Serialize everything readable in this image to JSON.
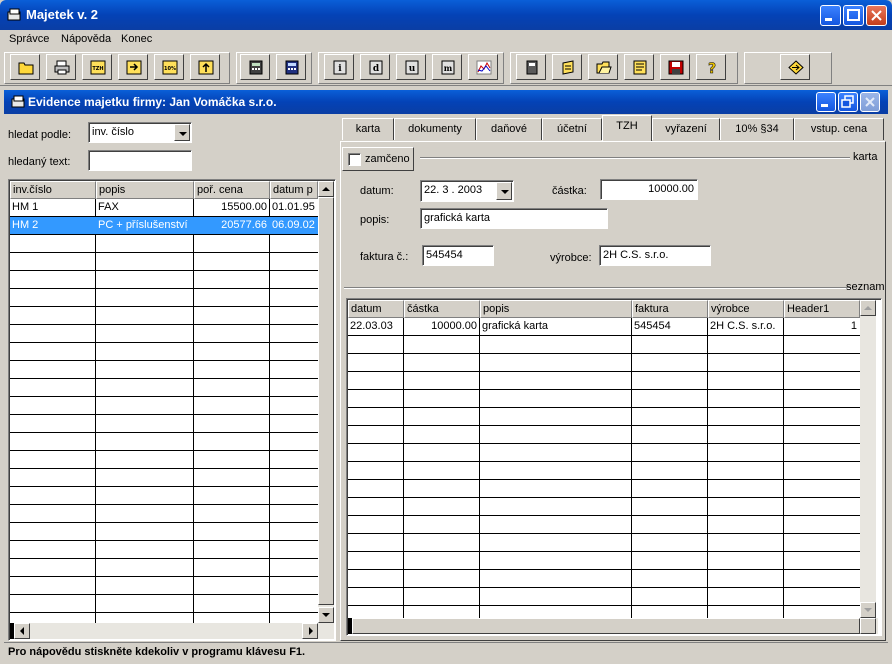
{
  "app": {
    "title": "Majetek v. 2",
    "menu": [
      "Správce",
      "Nápověda",
      "Konec"
    ],
    "menu_underline": [
      "S",
      "N",
      "K"
    ]
  },
  "toolbar": {
    "icons": [
      "folder-icon",
      "printer-icon",
      "tzh-icon",
      "export-icon",
      "percent-icon",
      "upload-icon",
      "calculator-icon",
      "calculator-blue-icon",
      "info-i-icon",
      "info-d-icon",
      "info-u-icon",
      "info-m-icon",
      "chart-icon",
      "book-icon",
      "edit-card-icon",
      "open-folder-icon",
      "note-icon",
      "save-disk-icon",
      "help-icon",
      "exit-diamond-icon"
    ],
    "icon_labels": {
      "tzh": "TZH",
      "percent": "10%"
    }
  },
  "child": {
    "title": "Evidence majetku firmy: Jan Vomáčka s.r.o."
  },
  "left": {
    "search_by_label": "hledat podle:",
    "search_by_value": "inv. číslo",
    "search_text_label": "hledaný text:",
    "search_text_value": "",
    "columns": [
      "inv.číslo",
      "popis",
      "poř. cena",
      "datum p"
    ],
    "rows": [
      [
        "HM 1",
        "FAX",
        "15500.00",
        "01.01.95"
      ],
      [
        "HM 2",
        "PC + příslušenství",
        "20577.66",
        "06.09.02"
      ]
    ],
    "selected_row": 1
  },
  "tabs": [
    "karta",
    "dokumenty",
    "daňové",
    "účetní",
    "TZH",
    "vyřazení",
    "10% §34",
    "vstup. cena"
  ],
  "active_tab": 4,
  "form": {
    "locked_label": "zamčeno",
    "locked": false,
    "section_label": "karta",
    "date_label": "datum:",
    "date_value": "22. 3 . 2003",
    "amount_label": "částka:",
    "amount_value": "10000.00",
    "desc_label": "popis:",
    "desc_value": "grafická karta",
    "invoice_label": "faktura č.:",
    "invoice_value": "545454",
    "maker_label": "výrobce:",
    "maker_value": "2H C.S. s.r.o.",
    "list_label": "seznam"
  },
  "list": {
    "columns": [
      "datum",
      "částka",
      "popis",
      "faktura",
      "výrobce",
      "Header1"
    ],
    "rows": [
      [
        "22.03.03",
        "10000.00",
        "grafická karta",
        "545454",
        "2H C.S. s.r.o.",
        "1"
      ]
    ]
  },
  "status": "Pro nápovědu stiskněte kdekoliv v programu klávesu F1.",
  "colors": {
    "title_blue": "#0442b6",
    "selection": "#3399ff",
    "face": "#d4d0c8"
  }
}
